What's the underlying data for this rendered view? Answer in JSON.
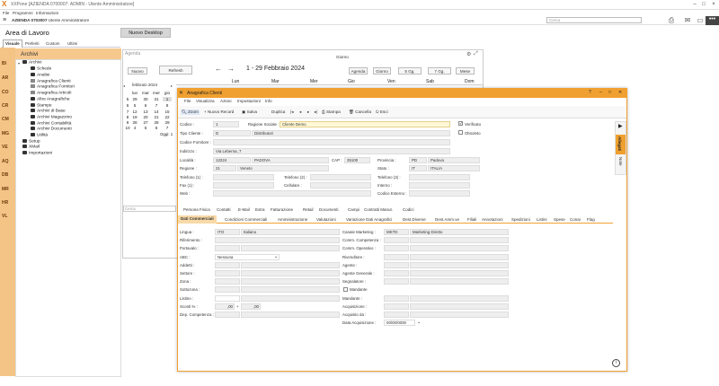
{
  "window": {
    "logo": "X",
    "title": "XXPone [AZIENDA 0700007: ADMIN - Utente Amministratore]"
  },
  "menubar": [
    "File",
    "Programmi",
    "Informazioni"
  ],
  "toolbar": {
    "azienda_code": "AZIENDA 0703007",
    "azienda_desc": "Utente Amministratore",
    "search_placeholder": "Cerca"
  },
  "left": {
    "title": "Area di Lavoro",
    "tabs": [
      "Visuale",
      "Preferiti",
      "Custom",
      "Ultimi"
    ],
    "vertical_items": [
      "BI",
      "AR",
      "CO",
      "CR",
      "CM",
      "MG",
      "VE",
      "AQ",
      "DB",
      "MR",
      "HR",
      "VL"
    ],
    "archivi_title": "Archivi",
    "tree": [
      "Archivi",
      "Schede",
      "Analisi",
      "Anagrafica Clienti",
      "Anagrafica Fornitori",
      "Anagrafica Articoli",
      "Altre Anagrafiche",
      "Stampe",
      "Archivi di Base",
      "Archivi Magazzino",
      "Archivi Contabilità",
      "Archivi Documenti",
      "Utilità",
      "Setup",
      "XMail",
      "Importazioni"
    ]
  },
  "desktop": {
    "new_desktop": "Nuovo Desktop"
  },
  "agenda": {
    "label": "Agenda",
    "nuovo": "Nuovo",
    "refresh": "Refresh",
    "giorno_label": "Giorno",
    "date_range": "1 - 29 Febbraio 2024",
    "view_buttons": [
      "Agenda",
      "Giorno",
      "5 Gg.",
      "7 Gg.",
      "Mese"
    ],
    "week_days": [
      "Lun",
      "Mar",
      "Mer",
      "Gio",
      "Ven",
      "Sab",
      "Dom"
    ],
    "month": "febbraio 2024",
    "cal_days_hdr": [
      "lun",
      "mar",
      "mer",
      "gio"
    ],
    "cal_rows": [
      [
        "5",
        "29",
        "30",
        "31",
        "1"
      ],
      [
        "6",
        "5",
        "6",
        "7",
        "8"
      ],
      [
        "7",
        "12",
        "13",
        "14",
        "15"
      ],
      [
        "8",
        "19",
        "20",
        "21",
        "22"
      ],
      [
        "9",
        "26",
        "27",
        "28",
        "29"
      ],
      [
        "10",
        "4",
        "5",
        "6",
        "7"
      ]
    ],
    "oggi": "Oggi: 1",
    "cerca": "Cerca"
  },
  "dialog": {
    "title": "Anagrafica Clienti",
    "menu": [
      "File",
      "Visualizza",
      "Azioni",
      "Impostazioni",
      "Info"
    ],
    "toolbar": [
      "Zoom",
      "Nuovo Record",
      "Salva",
      "Duplica",
      "Stampa",
      "Cancella",
      "Esci"
    ],
    "labels": {
      "codice": "Codice :",
      "ragione_sociale": "Ragione Sociale :",
      "tipo_cliente": "Tipo Cliente :",
      "codice_fornitore": "Codice Fornitore :",
      "indirizzo": "Indirizzo :",
      "localita": "Località :",
      "cap": "CAP :",
      "provincia": "Provincia :",
      "regione": "Regione :",
      "stato": "Stato :",
      "telefono1": "Telefono (1) :",
      "telefono2": "Telefono (2) :",
      "telefono3": "Telefono (3) :",
      "fax1": "Fax (1) :",
      "cellulare": "Cellulare :",
      "interno": "Interno :",
      "web": "Web :",
      "codice_esterno": "Codice Esterno :",
      "verificato": "Verificato",
      "obsoleto": "Obsoleto"
    },
    "values": {
      "codice": "1",
      "ragione_sociale": "Cliente Demo",
      "tipo_cliente_code": "D",
      "tipo_cliente": "Distributori",
      "indirizzo": "Via Leberna, 7",
      "localita_code": "12224",
      "localita": "PADOVA",
      "cap": "35100",
      "provincia_code": "PD",
      "provincia": "Padova",
      "regione_code": "21",
      "regione": "Veneto",
      "stato_code": "IT",
      "stato": "ITALIA"
    },
    "tabs_row1": [
      "Persona Fisica",
      "Contatti",
      "E-Mail",
      "Extra",
      "Fatturazione",
      "Retail",
      "Documenti",
      "Campi",
      "Contratti Manut.",
      "Codici"
    ],
    "tabs_row2": [
      "Dati Commerciali",
      "Condizioni Commerciali",
      "Amministrazione",
      "Valutazioni",
      "Variazione Dati Anagrafici",
      "Dest.Diverse",
      "Dest.Amm.ve",
      "Filiali",
      "Annotazioni",
      "Spedizioni",
      "Listini",
      "Spese",
      "Conai",
      "Flag"
    ],
    "commerciali_left": [
      "Lingua :",
      "Riferimento :",
      "Portavalo :",
      "ABC :",
      "Addetti :",
      "Settore :",
      "Zona :",
      "Sottozona :",
      "Listino :",
      "Sconti % :",
      "Dep. Competenza :"
    ],
    "commerciali_right": [
      "Canale Marketing :",
      "Comm. Competenza :",
      "Comm. Operativo :",
      "Rivenditore :",
      "Agente :",
      "Agente Generale :",
      "Segnalatore :",
      "Mandante",
      "Mandante :",
      "Acquisizione :",
      "Acquisito da :",
      "Data Acquisizione :"
    ],
    "lingua_code": "ITO",
    "lingua": "Italiano",
    "abc": "Nessuna",
    "sconto1": ",00",
    "sconto2": ",00",
    "canale_code": "MKTD",
    "canale": "Marketing Diretto",
    "data_acq": "00/00/0000",
    "side_tabs": [
      "Allegati",
      "Note"
    ]
  }
}
